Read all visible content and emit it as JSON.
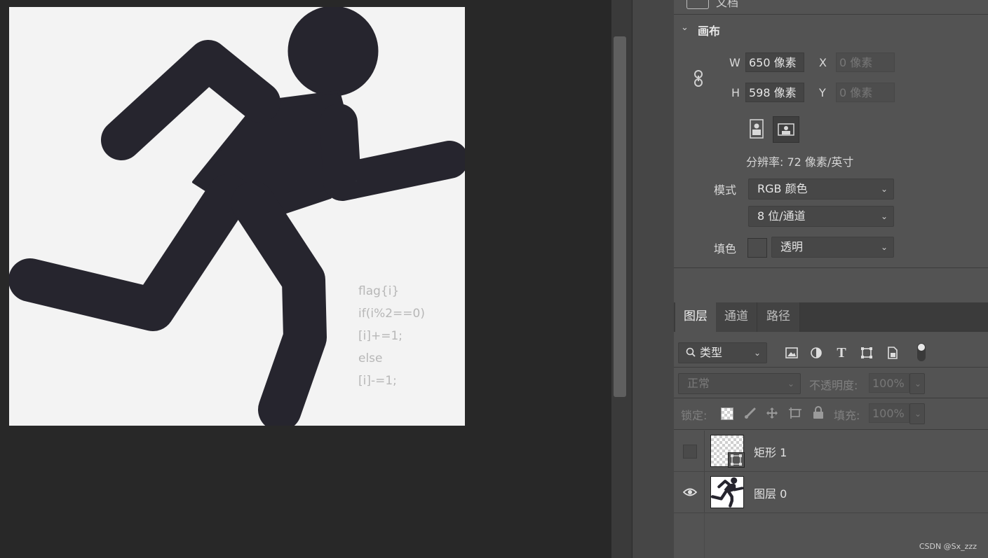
{
  "canvas": {
    "code_lines": [
      "flag{i}",
      "if(i%2==0)",
      "[i]+=1;",
      "else",
      "[i]-=1;"
    ]
  },
  "properties": {
    "top_section_label": "文档",
    "section_title": "画布",
    "width_label": "W",
    "width_value": "650 像素",
    "height_label": "H",
    "height_value": "598 像素",
    "x_label": "X",
    "x_value": "0 像素",
    "y_label": "Y",
    "y_value": "0 像素",
    "resolution": "分辨率: 72 像素/英寸",
    "mode_label": "模式",
    "mode_value": "RGB 颜色",
    "bit_depth": "8 位/通道",
    "fill_label": "填色",
    "fill_value": "透明"
  },
  "layers_panel": {
    "tabs": [
      {
        "label": "图层",
        "active": true
      },
      {
        "label": "通道",
        "active": false
      },
      {
        "label": "路径",
        "active": false
      }
    ],
    "filter_value": "类型",
    "blend_mode": "正常",
    "opacity_label": "不透明度:",
    "opacity_value": "100%",
    "lock_label": "锁定:",
    "fill_label": "填充:",
    "fill_value": "100%",
    "layers": [
      {
        "name": "矩形 1",
        "visible": false
      },
      {
        "name": "图层 0",
        "visible": true
      }
    ]
  },
  "watermark": "CSDN @Sx_zzz",
  "colors": {
    "figure": "#26252e",
    "canvas_bg": "#f3f3f3",
    "panel_bg": "#535353"
  }
}
